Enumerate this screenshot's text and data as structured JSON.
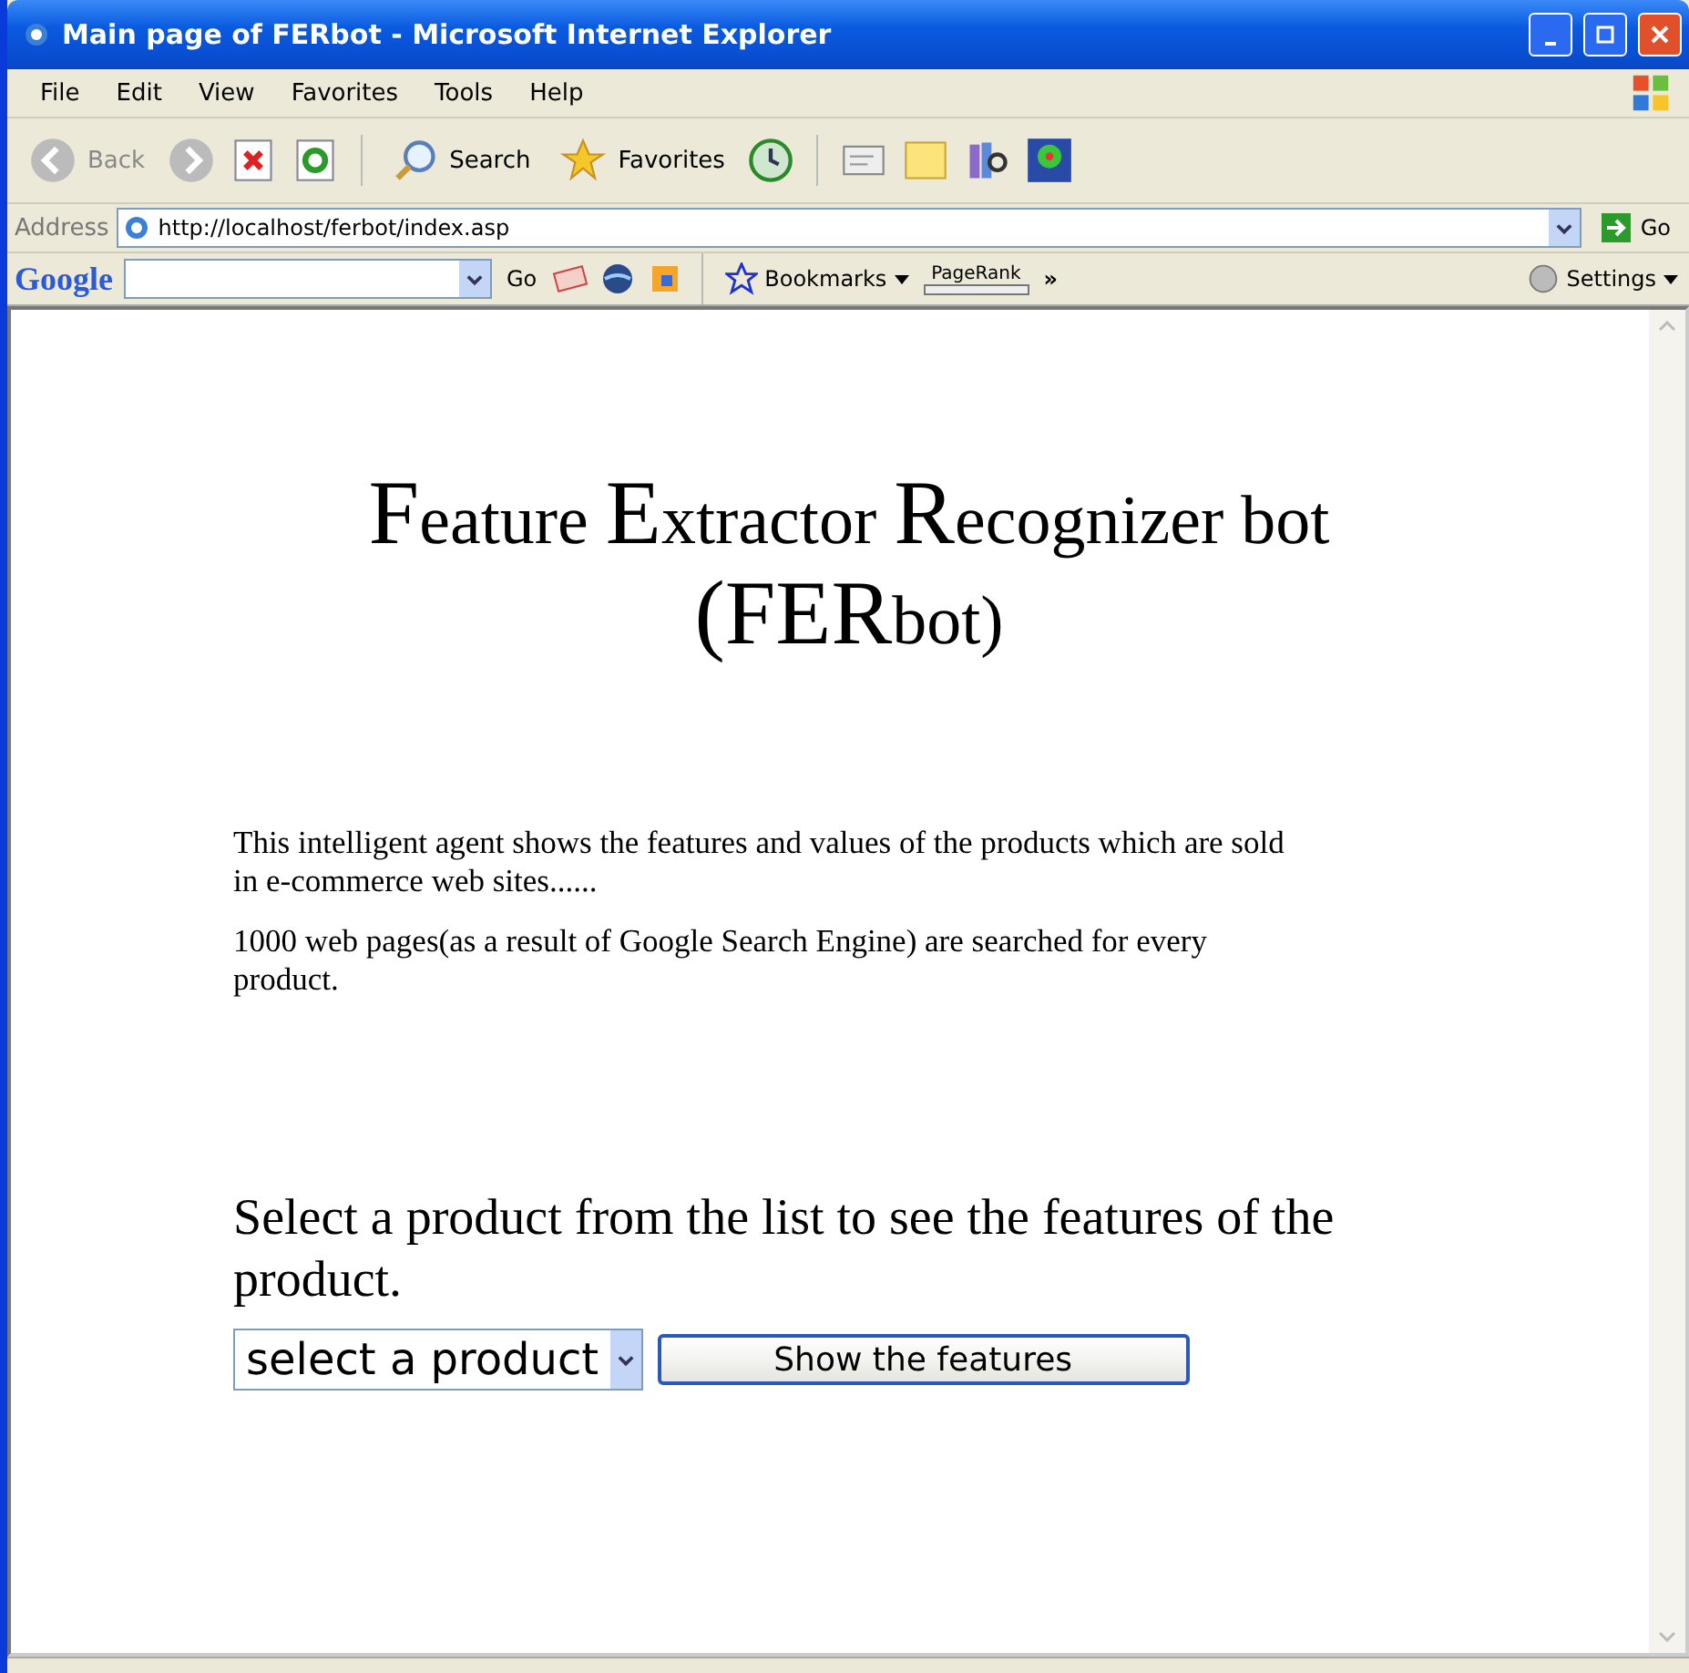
{
  "window": {
    "title": "Main page of FERbot - Microsoft Internet Explorer"
  },
  "menu": [
    "File",
    "Edit",
    "View",
    "Favorites",
    "Tools",
    "Help"
  ],
  "toolbar": {
    "back": "Back",
    "search": "Search",
    "favorites": "Favorites"
  },
  "address": {
    "label": "Address",
    "url": "http://localhost/ferbot/index.asp",
    "go": "Go"
  },
  "google_bar": {
    "logo": "Google",
    "go": "Go",
    "bookmarks": "Bookmarks",
    "pagerank": "PageRank",
    "more": "»",
    "settings": "Settings"
  },
  "page": {
    "heading_lines": [
      [
        {
          "kind": "initial",
          "text": "F"
        },
        {
          "kind": "rest",
          "text": "eature "
        },
        {
          "kind": "initial",
          "text": "E"
        },
        {
          "kind": "rest",
          "text": "xtractor "
        },
        {
          "kind": "initial",
          "text": "R"
        },
        {
          "kind": "rest",
          "text": "ecognizer bot"
        }
      ],
      [
        {
          "kind": "initial",
          "text": "(FER"
        },
        {
          "kind": "rest",
          "text": "bot)"
        }
      ]
    ],
    "paragraphs": [
      "This intelligent agent shows the features and values of the products which are sold in e-commerce web sites......",
      "1000 web pages(as a result of Google Search Engine) are searched for every product."
    ],
    "prompt": "Select a product from the list to see the features of the product.",
    "select": {
      "value": "select a product"
    },
    "button": "Show the features"
  }
}
